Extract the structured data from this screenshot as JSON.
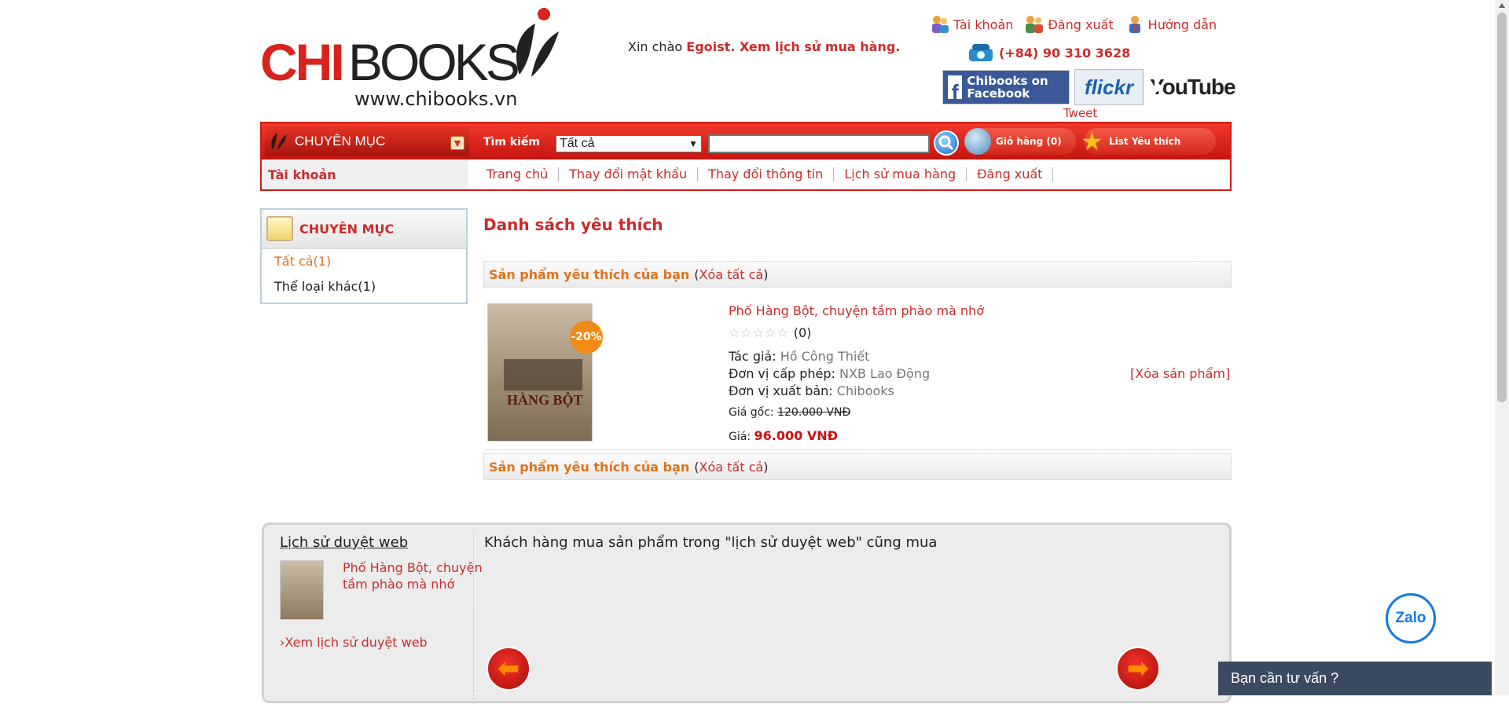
{
  "header": {
    "logo_text": "CHIBOOKS",
    "logo_url": "www.chibooks.vn",
    "greeting": "Xin chào",
    "greeting_user": "Egoist. Xem lịch sử mua hàng.",
    "top_links": [
      "Tài khoản",
      "Đăng xuất",
      "Hướng dẫn"
    ],
    "phone": "(+84) 90 310 3628",
    "social": {
      "facebook": "Chibooks on Facebook",
      "flickr": "flickr",
      "youtube": "YouTube",
      "tweet": "Tweet"
    }
  },
  "topbar": {
    "category_label": "CHUYÊN MỤC",
    "search_label": "Tìm kiếm",
    "search_select": "Tất cả",
    "search_value": "",
    "cart_label": "Giỏ hàng (0)",
    "wishlist_label": "List Yêu thích"
  },
  "account_bar": {
    "title": "Tài khoản",
    "links": [
      "Trang chủ",
      "Thay đổi mật khẩu",
      "Thay đổi thông tin",
      "Lịch sử mua hàng",
      "Đăng xuất"
    ]
  },
  "sidebar": {
    "title": "CHUYÊN MỤC",
    "items": [
      "Tất cả(1)",
      "Thể loại khác(1)"
    ]
  },
  "main": {
    "title": "Danh sách yêu thích",
    "bar_label": "Sản phẩm yêu thích của bạn",
    "clear_open": "(",
    "clear_all": "Xóa tất cả",
    "clear_close": ")",
    "product": {
      "name": "Phố Hàng Bột, chuyện tầm phào mà nhớ",
      "discount": "-20%",
      "cover_text": "HÀNG BỘT",
      "stars": "☆☆☆☆☆",
      "rating_count": "(0)",
      "author_label": "Tác giả:",
      "author": "Hồ Công Thiết",
      "license_label": "Đơn vị cấp phép:",
      "license": "NXB Lao Động",
      "publisher_label": "Đơn vị xuất bản:",
      "publisher": "Chibooks",
      "orig_price_label": "Giá gốc:",
      "orig_price": "120.000 VNĐ",
      "price_label": "Giá:",
      "price": "96.000 VNĐ",
      "remove": "[Xóa sản phẩm]"
    }
  },
  "bottom": {
    "history_title": "Lịch sử duyệt web",
    "history_item": "Phố Hàng Bột, chuyện tầm phào mà nhớ",
    "history_more": "Xem lịch sử duyệt web",
    "also_bought": "Khách hàng mua sản phẩm trong \"lịch sử duyệt web\" cũng mua"
  },
  "floating": {
    "zalo": "Zalo",
    "chat": "Bạn cần tư vấn ?"
  }
}
